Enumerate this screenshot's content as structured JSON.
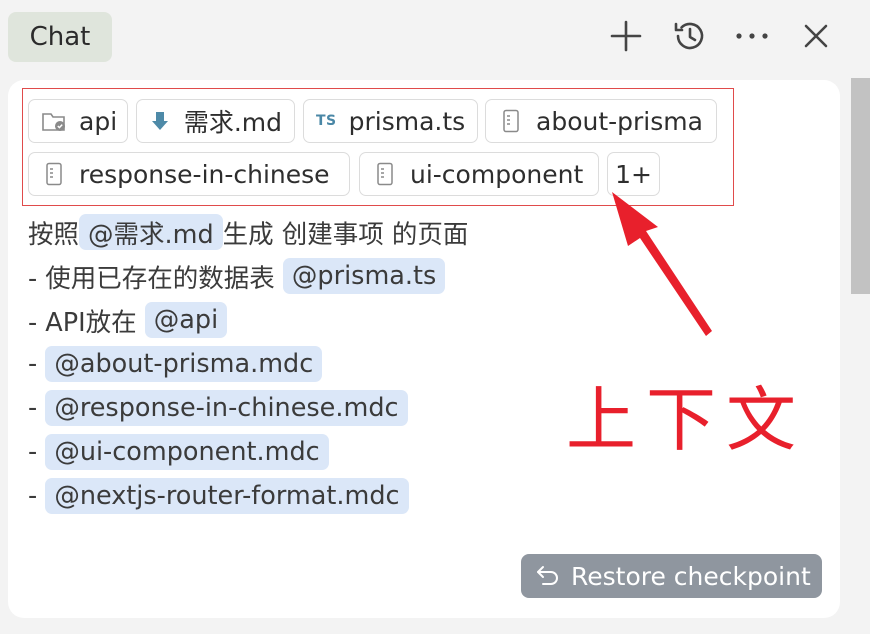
{
  "header": {
    "tab_label": "Chat",
    "icons": [
      "plus-icon",
      "history-icon",
      "more-icon",
      "close-icon"
    ]
  },
  "context": {
    "chips": [
      {
        "label": "api",
        "icon": "folder-icon"
      },
      {
        "label": "需求.md",
        "icon": "markdown-down-arrow-icon"
      },
      {
        "label": "prisma.ts",
        "icon": "typescript-icon",
        "icon_text": "TS"
      },
      {
        "label": "about-prisma",
        "icon": "file-rule-icon"
      },
      {
        "label": "response-in-chinese",
        "icon": "file-rule-icon"
      },
      {
        "label": "ui-component",
        "icon": "file-rule-icon"
      },
      {
        "label": "1+",
        "icon": ""
      }
    ]
  },
  "message": {
    "line1": {
      "prefix": "按照",
      "mention": "@需求.md",
      "suffix": " 生成 创建事项 的页面"
    },
    "line2": {
      "prefix": "- 使用已存在的数据表 ",
      "mention": "@prisma.ts"
    },
    "line3": {
      "prefix": "- API放在 ",
      "mention": "@api"
    },
    "line4": {
      "prefix": "- ",
      "mention": "@about-prisma.mdc"
    },
    "line5": {
      "prefix": "- ",
      "mention": "@response-in-chinese.mdc"
    },
    "line6": {
      "prefix": "- ",
      "mention": "@ui-component.mdc"
    },
    "line7": {
      "prefix": "- ",
      "mention": "@nextjs-router-format.mdc"
    }
  },
  "annotation": {
    "text": "上下文",
    "color": "#e8202c"
  },
  "restore": {
    "label": "Restore checkpoint",
    "icon": "undo-icon"
  },
  "colors": {
    "mention_bg": "#dbe7f8",
    "restore_bg": "#8f969f",
    "tab_bg": "#dfe5dc"
  }
}
